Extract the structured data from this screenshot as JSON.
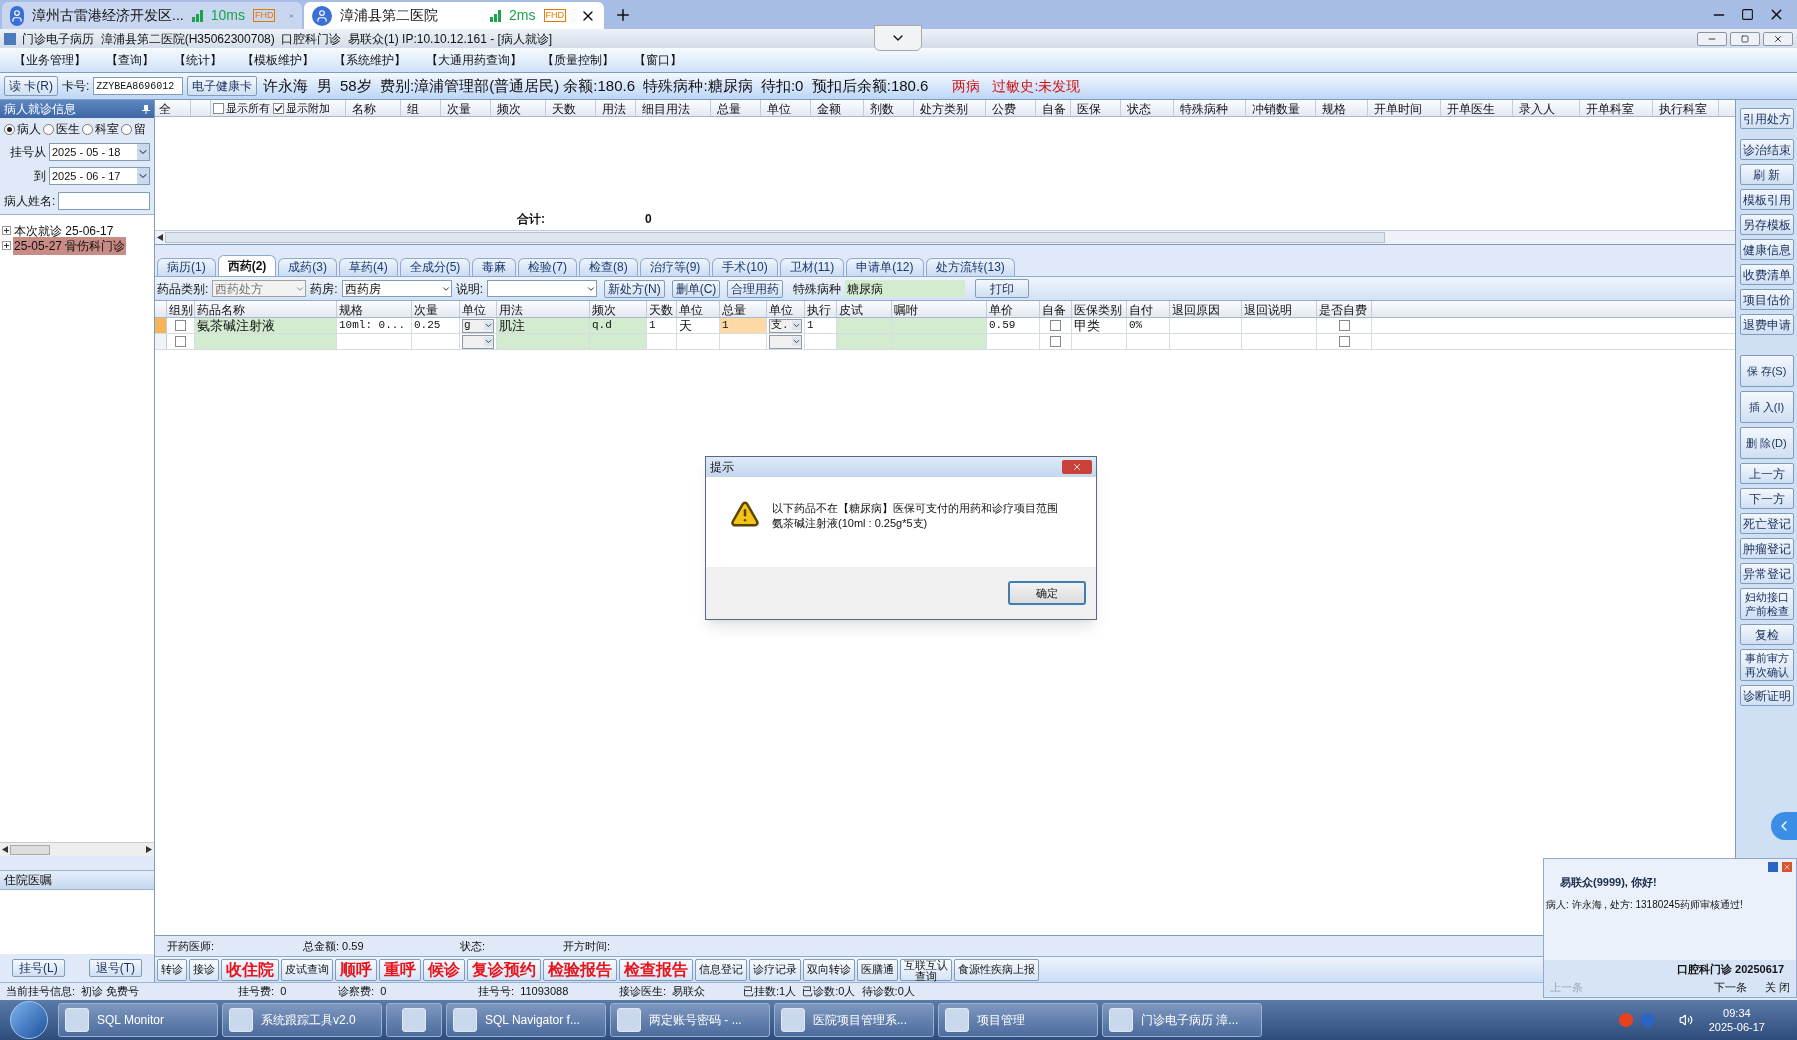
{
  "browser_tabs": [
    {
      "title": "漳州古雷港经济开发区...",
      "latency": "10ms",
      "badge": "FHD",
      "selected": false
    },
    {
      "title": "漳浦县第二医院",
      "latency": "2ms",
      "badge": "FHD",
      "selected": true
    }
  ],
  "app_title": "门诊电子病历  漳浦县第二医院(H35062300708)  口腔科门诊  易联众(1) IP:10.10.12.161 - [病人就诊]",
  "menu": [
    "【业务管理】",
    "【查询】",
    "【统计】",
    "【模板维护】",
    "【系统维护】",
    "【大通用药查询】",
    "【质量控制】",
    "【窗口】"
  ],
  "patient_bar": {
    "read_card": "读 卡(R)",
    "card_label": "卡号:",
    "card_value": "ZZYBEA8696012",
    "health_card": "电子健康卡",
    "info": "许永海  男  58岁  费别:漳浦管理部(普通居民) 余额:180.6  特殊病种:糖尿病  待扣:0  预扣后余额:180.6",
    "diseases": "两病",
    "allergy": "过敏史:未发现"
  },
  "left_panel": {
    "title": "病人就诊信息",
    "radios": [
      {
        "label": "病人",
        "selected": true
      },
      {
        "label": "医生",
        "selected": false
      },
      {
        "label": "科室",
        "selected": false
      },
      {
        "label": "留",
        "selected": false
      }
    ],
    "date_from_label": "挂号从",
    "date_from": "2025 - 05 - 18",
    "date_to_label": "到",
    "date_to": "2025 - 06 - 17",
    "name_label": "病人姓名:",
    "visits": [
      {
        "text": "本次就诊  25-06-17",
        "selected": false
      },
      {
        "text": "25-05-27  骨伤科门诊",
        "selected": true
      }
    ],
    "orders_title": "住院医嘱",
    "buttons": [
      "挂号(L)",
      "退号(T)"
    ]
  },
  "upper_grid": {
    "select_all": "全",
    "options": [
      {
        "label": "显示所有",
        "checked": false
      },
      {
        "label": "显示附加",
        "checked": true
      }
    ],
    "columns": [
      "名称",
      "组",
      "次量",
      "频次",
      "天数",
      "用法",
      "细目用法",
      "总量",
      "单位",
      "金额",
      "剂数",
      "处方类别",
      "公费",
      "自备",
      "医保",
      "状态",
      "特殊病种",
      "冲销数量",
      "规格",
      "开单时间",
      "开单医生",
      "录入人",
      "开单科室",
      "执行科室"
    ],
    "total_label": "合计:",
    "total_value": "0"
  },
  "tabs": [
    {
      "label": "病历(1)",
      "selected": false
    },
    {
      "label": "西药(2)",
      "selected": true
    },
    {
      "label": "成药(3)",
      "selected": false
    },
    {
      "label": "草药(4)",
      "selected": false
    },
    {
      "label": "全成分(5)",
      "selected": false
    },
    {
      "label": "毒麻",
      "selected": false
    },
    {
      "label": "检验(7)",
      "selected": false
    },
    {
      "label": "检查(8)",
      "selected": false
    },
    {
      "label": "治疗等(9)",
      "selected": false
    },
    {
      "label": "手术(10)",
      "selected": false
    },
    {
      "label": "卫材(11)",
      "selected": false
    },
    {
      "label": "申请单(12)",
      "selected": false
    },
    {
      "label": "处方流转(13)",
      "selected": false
    }
  ],
  "drug_toolbar": {
    "category_label": "药品类别:",
    "category_value": "西药处方",
    "pharmacy_label": "药房:",
    "pharmacy_value": "西药房",
    "note_label": "说明:",
    "buttons": [
      "新处方(N)",
      "删单(C)",
      "合理用药"
    ],
    "disease_label": "特殊病种",
    "disease_value": "糖尿病",
    "print": "打印"
  },
  "order_grid": {
    "columns": [
      "组别",
      "药品名称",
      "规格",
      "次量",
      "单位",
      "用法",
      "频次",
      "天数",
      "单位",
      "总量",
      "单位",
      "执行",
      "皮试",
      "嘱咐",
      "单价",
      "自备",
      "医保类别",
      "自付",
      "退回原因",
      "退回说明",
      "是否自费"
    ],
    "rows": [
      {
        "selected": true,
        "cells": [
          {
            "kind": "checkbox",
            "checked": false
          },
          "氨茶碱注射液",
          "10ml: 0...",
          "0.25",
          {
            "kind": "dropdown",
            "value": "g"
          },
          "肌注",
          "q.d",
          "1",
          "天",
          "1",
          {
            "kind": "dropdown",
            "value": "支."
          },
          "1",
          null,
          null,
          "0.59",
          {
            "kind": "checkbox",
            "checked": false
          },
          "甲类",
          "0%",
          null,
          null,
          {
            "kind": "checkbox",
            "checked": false
          }
        ]
      },
      {
        "selected": false,
        "cells": [
          {
            "kind": "checkbox",
            "checked": false
          },
          null,
          null,
          null,
          {
            "kind": "dropdown"
          },
          null,
          null,
          null,
          null,
          null,
          {
            "kind": "dropdown"
          },
          null,
          null,
          null,
          null,
          {
            "kind": "checkbox",
            "checked": false
          },
          null,
          null,
          null,
          null,
          {
            "kind": "checkbox",
            "checked": false
          }
        ]
      }
    ]
  },
  "footer": {
    "doctor_label": "开药医师:",
    "total": "总金额: 0.59",
    "status_label": "状态:",
    "time_label": "开方时间:"
  },
  "action_buttons": [
    {
      "label": "转诊",
      "kind": "normal"
    },
    {
      "label": "接诊",
      "kind": "normal"
    },
    {
      "label": "收住院",
      "kind": "alert"
    },
    {
      "label": "皮试查询",
      "kind": "normal"
    },
    {
      "label": "顺呼",
      "kind": "alert"
    },
    {
      "label": "重呼",
      "kind": "alert"
    },
    {
      "label": "候诊",
      "kind": "alert"
    },
    {
      "label": "复诊预约",
      "kind": "alert"
    },
    {
      "label": "检验报告",
      "kind": "alert"
    },
    {
      "label": "检查报告",
      "kind": "alert"
    },
    {
      "label": "信息登记",
      "kind": "normal"
    },
    {
      "label": "诊疗记录",
      "kind": "normal"
    },
    {
      "label": "双向转诊",
      "kind": "normal"
    },
    {
      "label": "医膳通",
      "kind": "normal"
    },
    {
      "label": "互联互认查询",
      "kind": "normal"
    },
    {
      "label": "食源性疾病上报",
      "kind": "normal"
    }
  ],
  "status_bar": [
    "当前挂号信息:  初诊 免费号",
    "挂号费:  0",
    "诊察费:  0",
    "挂号号:  11093088",
    "接诊医生:  易联众",
    "已挂数:1人  已诊数:0人  待诊数:0人"
  ],
  "right_toolbar": [
    "引用处方",
    "诊治结束",
    "刷 新",
    "模板引用",
    "另存模板",
    "健康信息",
    "收费清单",
    "项目估价",
    "退费申请",
    "保 存(S)",
    "插 入(I)",
    "删 除(D)",
    "上一方",
    "下一方",
    "死亡登记",
    "肿瘤登记",
    "异常登记",
    "妇幼接口产前检查",
    "复检",
    "事前审方再次确认",
    "诊断证明"
  ],
  "dialog": {
    "title": "提示",
    "message": "以下药品不在【糖尿病】医保可支付的用药和诊疗项目范围",
    "detail": "氨茶碱注射液(10ml : 0.25g*5支)",
    "ok": "确定"
  },
  "notification": {
    "greeting": "易联众(9999), 你好!",
    "message": "病人: 许永海 , 处方: 13180245药师审核通过!",
    "footer": "口腔科门诊  20250617",
    "prev": "上一条",
    "next": "下一条",
    "close": "关 闭"
  },
  "taskbar": [
    {
      "kind": "labeled",
      "label": "SQL Monitor"
    },
    {
      "kind": "labeled",
      "label": "系统跟踪工具v2.0"
    },
    {
      "kind": "icon"
    },
    {
      "kind": "labeled",
      "label": "SQL Navigator f..."
    },
    {
      "kind": "labeled",
      "label": "两定账号密码 - ..."
    },
    {
      "kind": "labeled",
      "label": "医院项目管理系..."
    },
    {
      "kind": "labeled",
      "label": "项目管理"
    },
    {
      "kind": "labeled",
      "label": "门诊电子病历  漳..."
    }
  ],
  "clock": {
    "time": "09:34",
    "date": "2025-06-17"
  }
}
